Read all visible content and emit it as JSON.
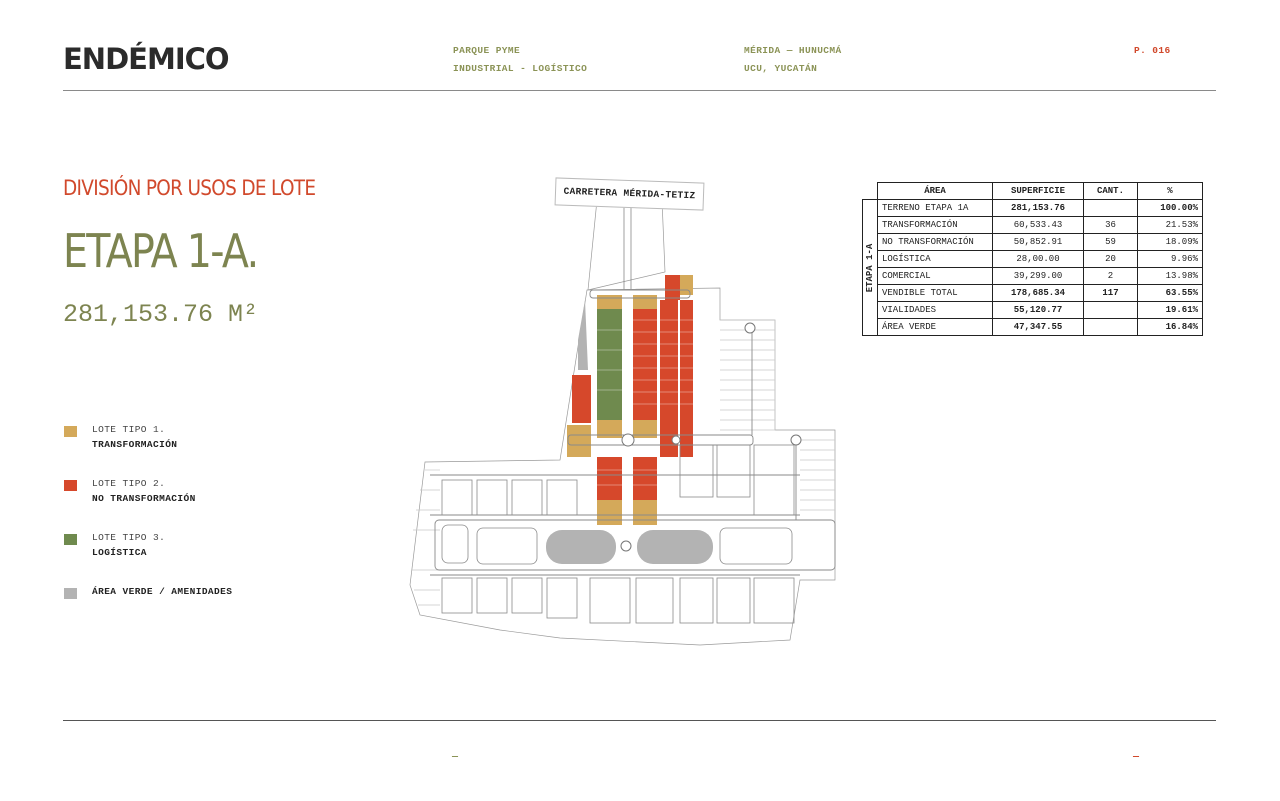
{
  "header": {
    "logo": "ENDÉMICO",
    "project_line1": "PARQUE PYME",
    "project_line2": "INDUSTRIAL - LOGÍSTICO",
    "location_line1": "MÉRIDA — HUNUCMÁ",
    "location_line2": "UCU, YUCATÁN",
    "page": "P. 016"
  },
  "section_title": "DIVISIÓN POR USOS DE LOTE",
  "stage_title": "ETAPA 1-A.",
  "stage_area": "281,153.76 M²",
  "legend": [
    {
      "name": "LOTE TIPO 1.",
      "desc": "TRANSFORMACIÓN",
      "color": "#d4a95a"
    },
    {
      "name": "LOTE TIPO 2.",
      "desc": "NO TRANSFORMACIÓN",
      "color": "#d6482b"
    },
    {
      "name": "LOTE TIPO 3.",
      "desc": "LOGÍSTICA",
      "color": "#6f8a4e"
    },
    {
      "name": "",
      "desc": "ÁREA VERDE / AMENIDADES",
      "color": "#b3b3b3"
    }
  ],
  "map": {
    "road_label": "CARRETERA MÉRIDA-TETIZ"
  },
  "table": {
    "row_group_label": "ETAPA 1-A",
    "headers": [
      "ÁREA",
      "SUPERFICIE",
      "CANT.",
      "%"
    ],
    "rows": [
      {
        "area": "TERRENO ETAPA 1A",
        "superficie": "281,153.76",
        "cant": "",
        "pct": "100.00%"
      },
      {
        "area": "TRANSFORMACIÓN",
        "superficie": "60,533.43",
        "cant": "36",
        "pct": "21.53%"
      },
      {
        "area": "NO TRANSFORMACIÓN",
        "superficie": "50,852.91",
        "cant": "59",
        "pct": "18.09%"
      },
      {
        "area": "LOGÍSTICA",
        "superficie": "28,00.00",
        "cant": "20",
        "pct": "9.96%"
      },
      {
        "area": "COMERCIAL",
        "superficie": "39,299.00",
        "cant": "2",
        "pct": "13.98%"
      },
      {
        "area": "VENDIBLE TOTAL",
        "superficie": "178,685.34",
        "cant": "117",
        "pct": "63.55%"
      },
      {
        "area": "VIALIDADES",
        "superficie": "55,120.77",
        "cant": "",
        "pct": "19.61%"
      },
      {
        "area": "ÁREA VERDE",
        "superficie": "47,347.55",
        "cant": "",
        "pct": "16.84%"
      }
    ]
  },
  "footer": {
    "left_mark": "—",
    "right_mark": "—"
  }
}
